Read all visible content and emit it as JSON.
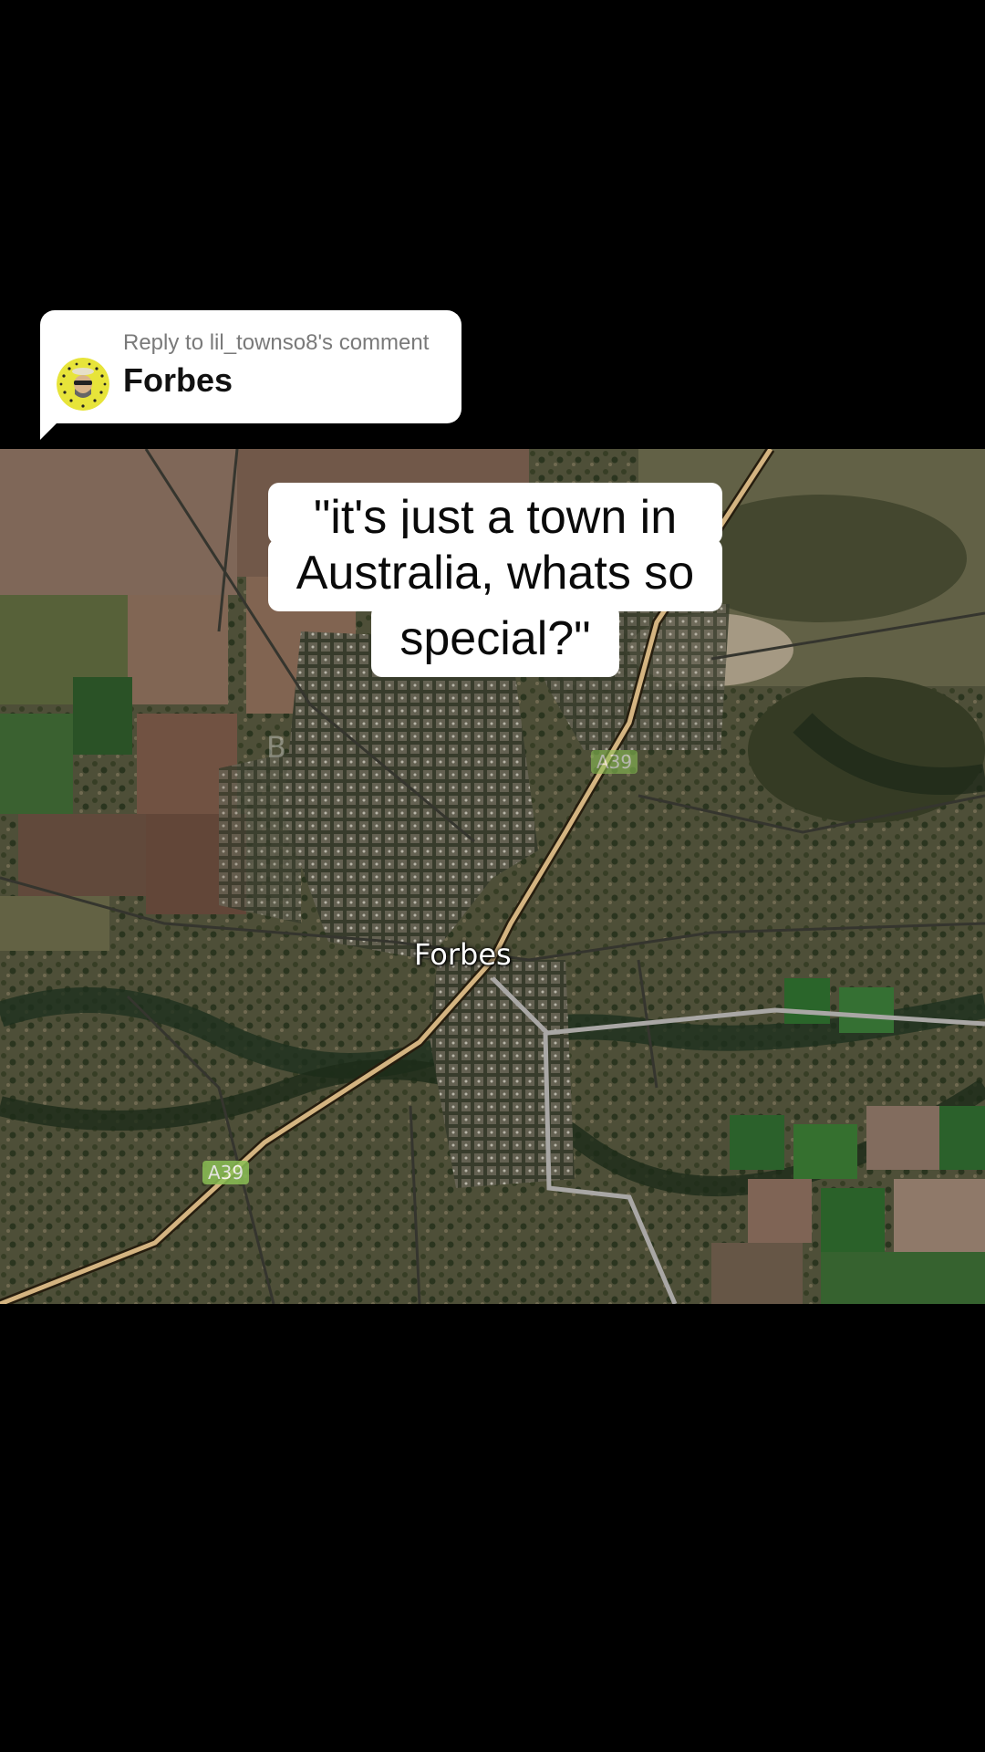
{
  "reply": {
    "label": "Reply to lil_townso8's comment",
    "text": "Forbes"
  },
  "caption": {
    "line1": "\"it's just a town in",
    "line2": "Australia, whats so",
    "line3": "special?\""
  },
  "map": {
    "town_label": "Forbes",
    "road_shields": [
      "A39",
      "A39"
    ]
  }
}
